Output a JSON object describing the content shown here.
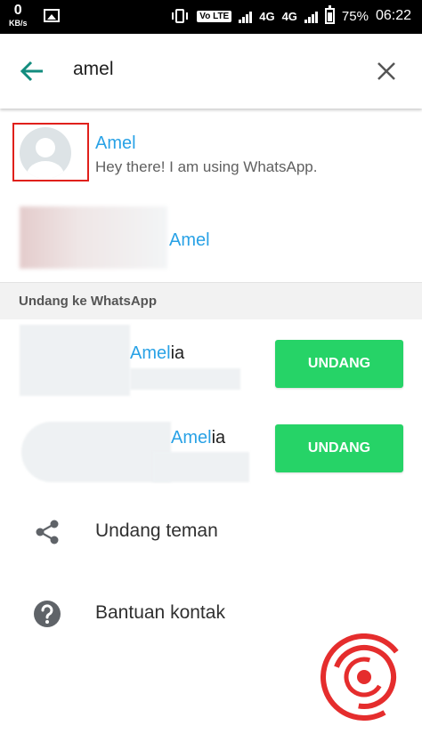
{
  "status_bar": {
    "speed_value": "0",
    "speed_unit": "KB/s",
    "volte": "Vo LTE",
    "net1": "4G",
    "net2": "4G",
    "battery": "75%",
    "time": "06:22"
  },
  "search": {
    "query": "amel"
  },
  "results": [
    {
      "name": "Amel",
      "status": "Hey there! I am using WhatsApp."
    },
    {
      "name": "Amel"
    }
  ],
  "invite_section": {
    "title": "Undang ke WhatsApp",
    "contacts": [
      {
        "name_highlight": "Amel",
        "name_rest": "ia",
        "button": "UNDANG"
      },
      {
        "name_highlight": "Amel",
        "name_rest": "ia",
        "button": "UNDANG"
      }
    ]
  },
  "actions": [
    {
      "icon": "share-icon",
      "label": "Undang teman"
    },
    {
      "icon": "help-icon",
      "label": "Bantuan kontak"
    }
  ],
  "colors": {
    "accent_blue": "#29a2e6",
    "button_green": "#26d367",
    "highlight_red": "#e0201b"
  }
}
